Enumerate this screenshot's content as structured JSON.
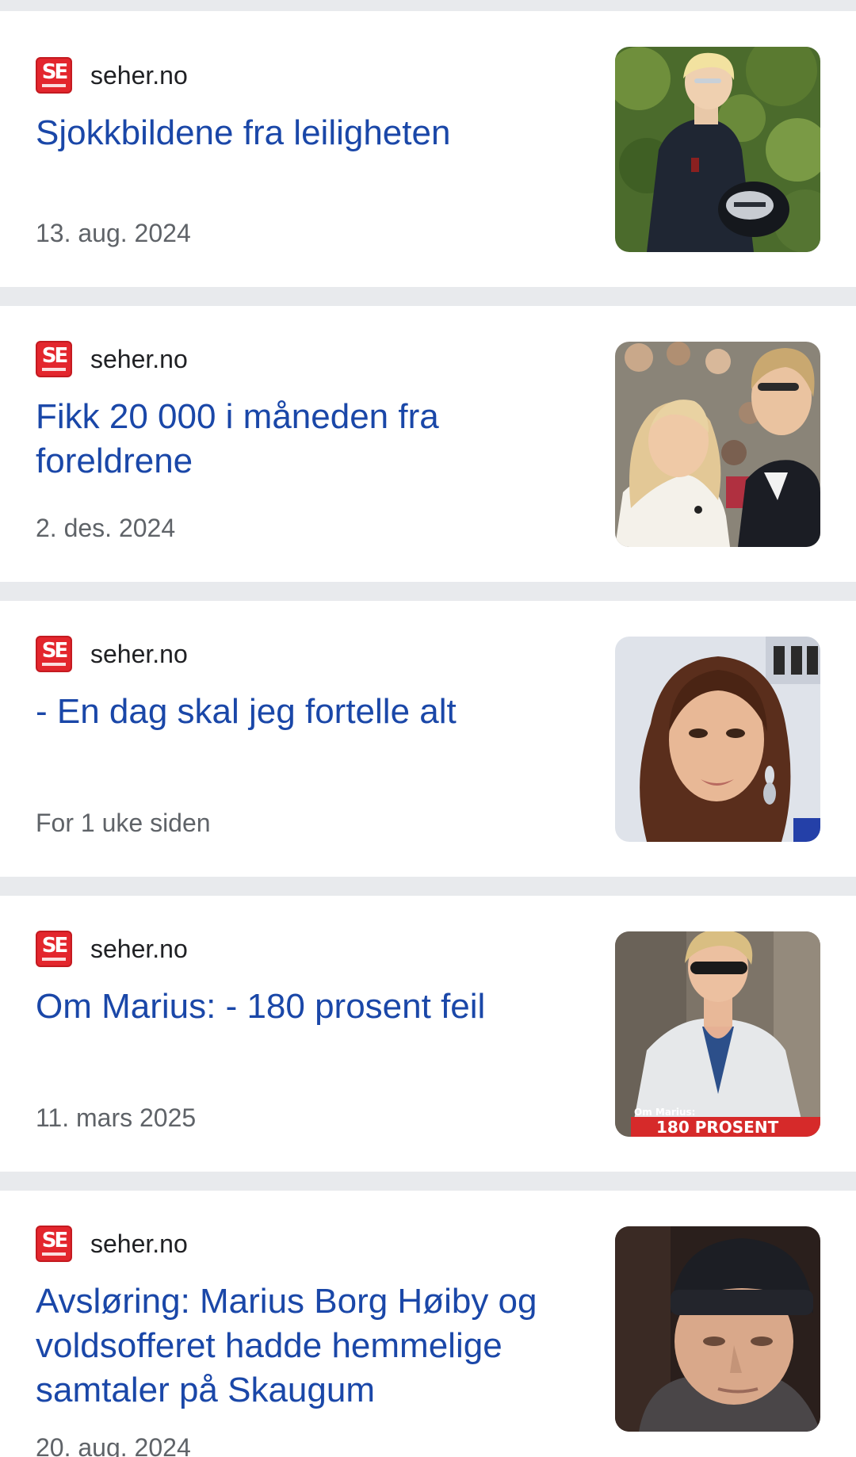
{
  "results": [
    {
      "source": "seher.no",
      "logo_text": "SE",
      "title": "Sjokkbildene fra leiligheten",
      "date": "13. aug. 2024",
      "thumbnail": "man-in-hoodie-photo"
    },
    {
      "source": "seher.no",
      "logo_text": "SE",
      "title": "Fikk 20 000 i måneden fra foreldrene",
      "date": "2. des. 2024",
      "thumbnail": "woman-and-man-photo"
    },
    {
      "source": "seher.no",
      "logo_text": "SE",
      "title": "- En dag skal jeg fortelle alt",
      "date": "For 1 uke siden",
      "thumbnail": "woman-portrait-photo"
    },
    {
      "source": "seher.no",
      "logo_text": "SE",
      "title": "Om Marius: - 180 prosent feil",
      "date": "11. mars 2025",
      "thumbnail": "man-in-sunglasses-photo",
      "thumbnail_caption": [
        "Om Marius:",
        "180 PROSENT"
      ]
    },
    {
      "source": "seher.no",
      "logo_text": "SE",
      "title": "Avsløring: Marius Borg Høiby og voldsofferet hadde hemmelige samtaler på Skaugum",
      "date": "20. aug. 2024",
      "thumbnail": "man-in-beanie-photo"
    }
  ],
  "colors": {
    "headline": "#1a47a8",
    "source_text": "#202124",
    "date_text": "#5f6368",
    "separator": "#e8eaed",
    "logo_red": "#e3262d"
  }
}
